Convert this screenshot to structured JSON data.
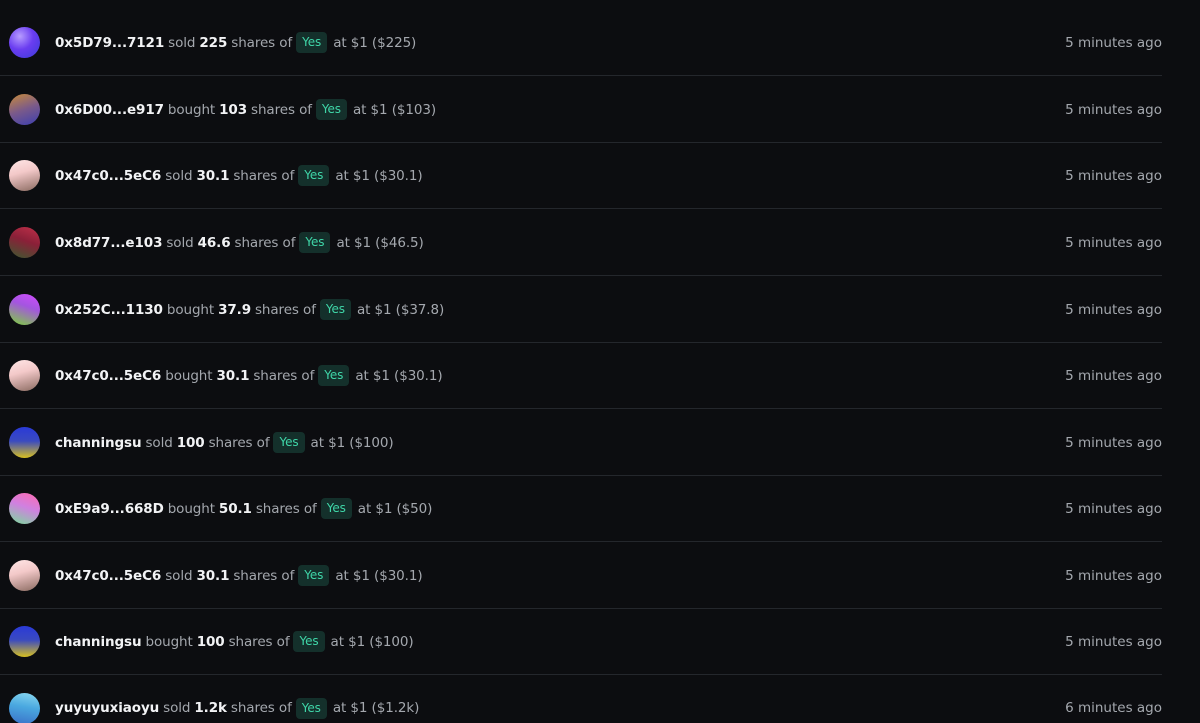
{
  "badge_color": "#3fd6a8",
  "trades": [
    {
      "user": "0x5D79...7121",
      "action": "sold",
      "amount": "225",
      "shares_of": "shares of",
      "outcome": "Yes",
      "price": "at $1 ($225)",
      "time": "5 minutes ago"
    },
    {
      "user": "0x6D00...e917",
      "action": "bought",
      "amount": "103",
      "shares_of": "shares of",
      "outcome": "Yes",
      "price": "at $1 ($103)",
      "time": "5 minutes ago"
    },
    {
      "user": "0x47c0...5eC6",
      "action": "sold",
      "amount": "30.1",
      "shares_of": "shares of",
      "outcome": "Yes",
      "price": "at $1 ($30.1)",
      "time": "5 minutes ago"
    },
    {
      "user": "0x8d77...e103",
      "action": "sold",
      "amount": "46.6",
      "shares_of": "shares of",
      "outcome": "Yes",
      "price": "at $1 ($46.5)",
      "time": "5 minutes ago"
    },
    {
      "user": "0x252C...1130",
      "action": "bought",
      "amount": "37.9",
      "shares_of": "shares of",
      "outcome": "Yes",
      "price": "at $1 ($37.8)",
      "time": "5 minutes ago"
    },
    {
      "user": "0x47c0...5eC6",
      "action": "bought",
      "amount": "30.1",
      "shares_of": "shares of",
      "outcome": "Yes",
      "price": "at $1 ($30.1)",
      "time": "5 minutes ago"
    },
    {
      "user": "channingsu",
      "action": "sold",
      "amount": "100",
      "shares_of": "shares of",
      "outcome": "Yes",
      "price": "at $1 ($100)",
      "time": "5 minutes ago"
    },
    {
      "user": "0xE9a9...668D",
      "action": "bought",
      "amount": "50.1",
      "shares_of": "shares of",
      "outcome": "Yes",
      "price": "at $1 ($50)",
      "time": "5 minutes ago"
    },
    {
      "user": "0x47c0...5eC6",
      "action": "sold",
      "amount": "30.1",
      "shares_of": "shares of",
      "outcome": "Yes",
      "price": "at $1 ($30.1)",
      "time": "5 minutes ago"
    },
    {
      "user": "channingsu",
      "action": "bought",
      "amount": "100",
      "shares_of": "shares of",
      "outcome": "Yes",
      "price": "at $1 ($100)",
      "time": "5 minutes ago"
    },
    {
      "user": "yuyuyuxiaoyu",
      "action": "sold",
      "amount": "1.2k",
      "shares_of": "shares of",
      "outcome": "Yes",
      "price": "at $1 ($1.2k)",
      "time": "6 minutes ago"
    }
  ]
}
